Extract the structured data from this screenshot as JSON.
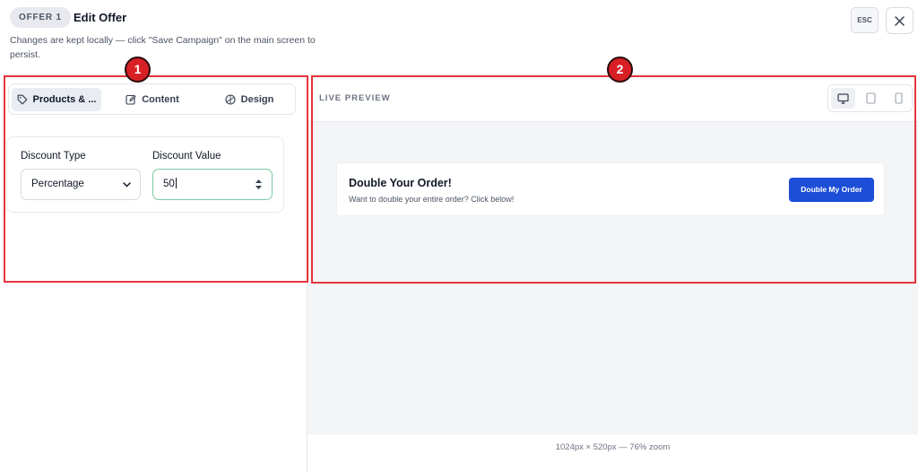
{
  "header": {
    "badge": "OFFER 1",
    "title": "Edit Offer",
    "note": "Changes are kept locally — click \"Save Campaign\" on the main screen to persist.",
    "esc_label": "ESC",
    "close_icon": "close-icon"
  },
  "tabs": [
    {
      "label": "Products & ...",
      "icon": "tag-icon",
      "active": true
    },
    {
      "label": "Content",
      "icon": "edit-icon",
      "active": false
    },
    {
      "label": "Design",
      "icon": "palette-icon",
      "active": false
    }
  ],
  "form": {
    "discount_type_label": "Discount Type",
    "discount_type_value": "Percentage",
    "discount_value_label": "Discount Value",
    "discount_value": "50"
  },
  "preview": {
    "label": "LIVE PREVIEW",
    "devices": [
      {
        "icon": "desktop-icon",
        "active": true
      },
      {
        "icon": "tablet-icon",
        "active": false
      },
      {
        "icon": "mobile-icon",
        "active": false
      }
    ],
    "offer_headline": "Double Your Order!",
    "offer_subtext": "Want to double your entire order? Click below!",
    "offer_button": "Double My Order",
    "zoom_note": "1024px × 520px — 76% zoom"
  },
  "annotations": [
    "1",
    "2"
  ],
  "colors": {
    "cta": "#1d4ed8",
    "annotation": "#e5353b",
    "focus_border": "#7cc9a3"
  }
}
